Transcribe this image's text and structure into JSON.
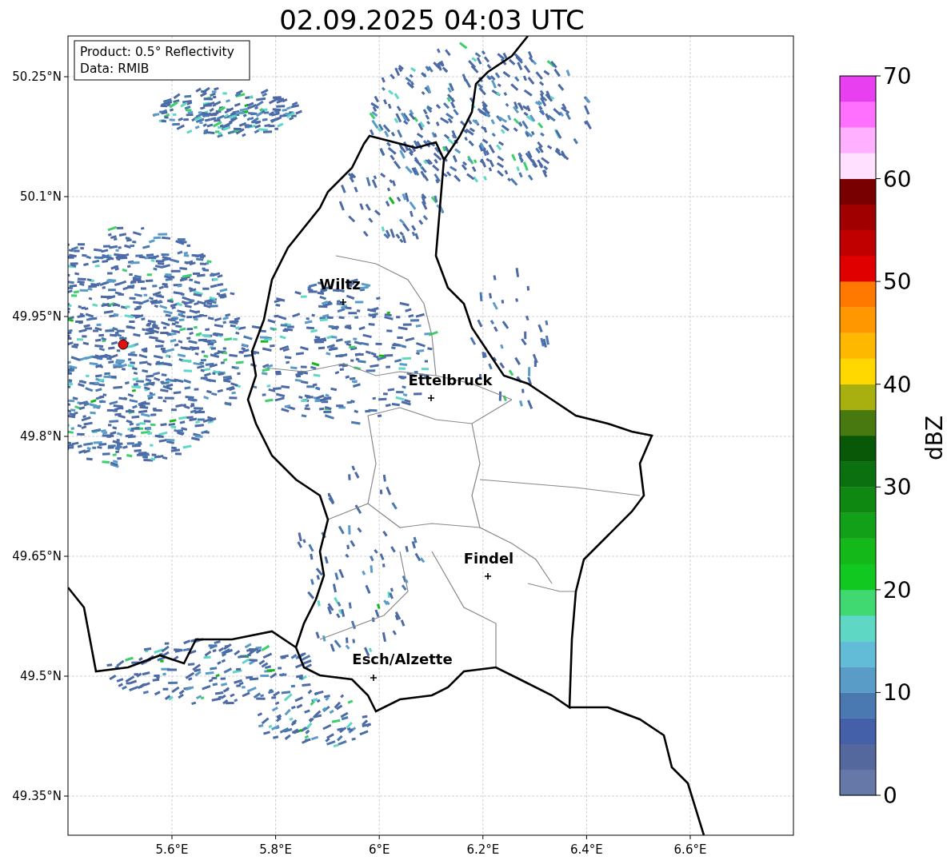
{
  "title": "02.09.2025 04:03 UTC",
  "info_box": [
    "Product: 0.5° Reflectivity",
    "Data: RMIB"
  ],
  "map": {
    "lat_labels": [
      "50.25°N",
      "50.1°N",
      "49.95°N",
      "49.8°N",
      "49.65°N",
      "49.5°N",
      "49.35°N"
    ],
    "lon_labels": [
      "5.6°E",
      "5.8°E",
      "6°E",
      "6.2°E",
      "6.4°E",
      "6.6°E"
    ],
    "cities": [
      {
        "name": "Wiltz"
      },
      {
        "name": "Ettelbruck"
      },
      {
        "name": "Findel"
      },
      {
        "name": "Esch/Alzette"
      }
    ]
  },
  "colorbar": {
    "label": "dBZ",
    "ticks": [
      "70",
      "60",
      "50",
      "40",
      "30",
      "20",
      "10",
      "0"
    ],
    "segments": [
      {
        "color": "#6678a8"
      },
      {
        "color": "#54689e"
      },
      {
        "color": "#4460a8"
      },
      {
        "color": "#4a78b0"
      },
      {
        "color": "#5a9cc8"
      },
      {
        "color": "#62bcd8"
      },
      {
        "color": "#5ed8c4"
      },
      {
        "color": "#40d870"
      },
      {
        "color": "#10c820"
      },
      {
        "color": "#14b818"
      },
      {
        "color": "#12a018"
      },
      {
        "color": "#0e8810"
      },
      {
        "color": "#0a7010"
      },
      {
        "color": "#085808"
      },
      {
        "color": "#487810"
      },
      {
        "color": "#a8b010"
      },
      {
        "color": "#ffd800"
      },
      {
        "color": "#ffb800"
      },
      {
        "color": "#ff9800"
      },
      {
        "color": "#ff7800"
      },
      {
        "color": "#e00000"
      },
      {
        "color": "#c00000"
      },
      {
        "color": "#a00000"
      },
      {
        "color": "#780000"
      },
      {
        "color": "#ffe0ff"
      },
      {
        "color": "#ffb0ff"
      },
      {
        "color": "#ff70ff"
      },
      {
        "color": "#e840f0"
      }
    ]
  }
}
